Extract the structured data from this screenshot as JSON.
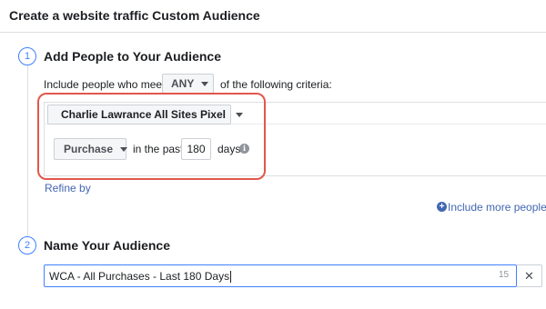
{
  "header": {
    "title": "Create a website traffic Custom Audience"
  },
  "step1": {
    "number": "1",
    "title": "Add People to Your Audience",
    "include_prefix": "Include people who meet",
    "match_select": "ANY",
    "include_suffix": "of the following criteria:",
    "pixel_select": "Charlie Lawrance All Sites Pixel",
    "event_select": "Purchase",
    "in_the_past": "in the past",
    "days_value": "180",
    "days_label": "days",
    "refine_link": "Refine by",
    "include_more_link": "Include more people"
  },
  "step2": {
    "number": "2",
    "title": "Name Your Audience",
    "name_value": "WCA - All Purchases - Last 180 Days",
    "char_count": "15",
    "clear_symbol": "✕"
  },
  "colors": {
    "accent_blue": "#4080ff",
    "link_blue": "#4267b2",
    "highlight_red": "#e2574c",
    "pixel_green": "#42b72a"
  }
}
